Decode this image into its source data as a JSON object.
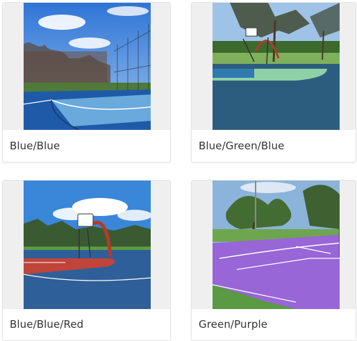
{
  "cards": [
    {
      "label": "Blue/Blue"
    },
    {
      "label": "Blue/Green/Blue"
    },
    {
      "label": "Blue/Blue/Red"
    },
    {
      "label": "Green/Purple"
    }
  ]
}
